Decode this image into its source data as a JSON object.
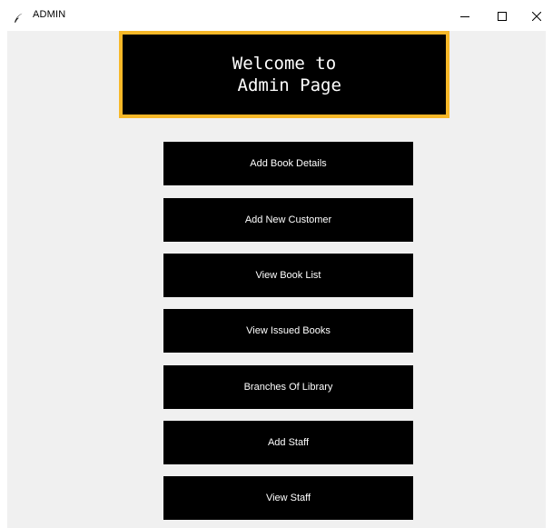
{
  "window": {
    "title": "ADMIN",
    "icons": {
      "app": "feather-icon",
      "minimize": "minimize-icon",
      "maximize": "maximize-icon",
      "close": "close-icon"
    }
  },
  "heading": {
    "text": "Welcome to\n Admin Page",
    "border_color": "#f7b828",
    "background": "#000000",
    "text_color": "#ffffff"
  },
  "buttons": [
    {
      "label": "Add Book Details"
    },
    {
      "label": "Add New Customer"
    },
    {
      "label": "View Book List"
    },
    {
      "label": "View Issued Books"
    },
    {
      "label": "Branches Of Library"
    },
    {
      "label": "Add Staff"
    },
    {
      "label": "View Staff"
    }
  ],
  "colors": {
    "window_background": "#f0f0f0",
    "button_background": "#000000",
    "button_text": "#ffffff"
  }
}
